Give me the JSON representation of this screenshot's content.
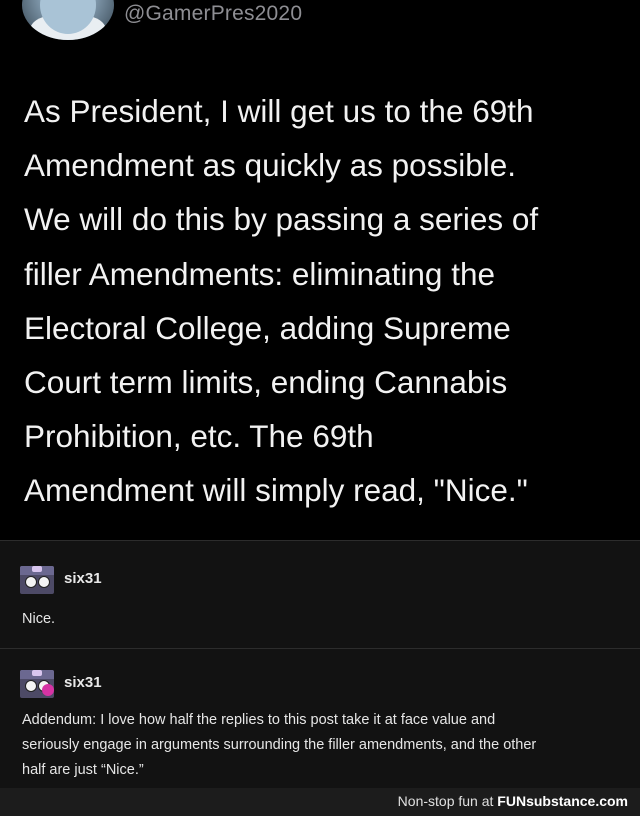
{
  "tweet": {
    "handle": "@GamerPres2020",
    "lines": [
      "As President, I will get us to the 69th",
      "Amendment as quickly as possible.",
      "We will do this by passing a series of",
      "filler Amendments: eliminating the",
      "Electoral College, adding Supreme",
      "Court term limits, ending Cannabis",
      "Prohibition, etc. The 69th",
      "Amendment will simply read, \"Nice.\""
    ]
  },
  "replies": [
    {
      "username": "six31",
      "text": "Nice."
    },
    {
      "username": "six31",
      "lines": [
        "Addendum: I love how half the replies to this post take it at face value and",
        "seriously engage in arguments surrounding the filler amendments, and the other",
        "half are just “Nice.”"
      ]
    }
  ],
  "footer": {
    "text": "Non-stop fun at",
    "brand": "FUNsubstance.com"
  }
}
